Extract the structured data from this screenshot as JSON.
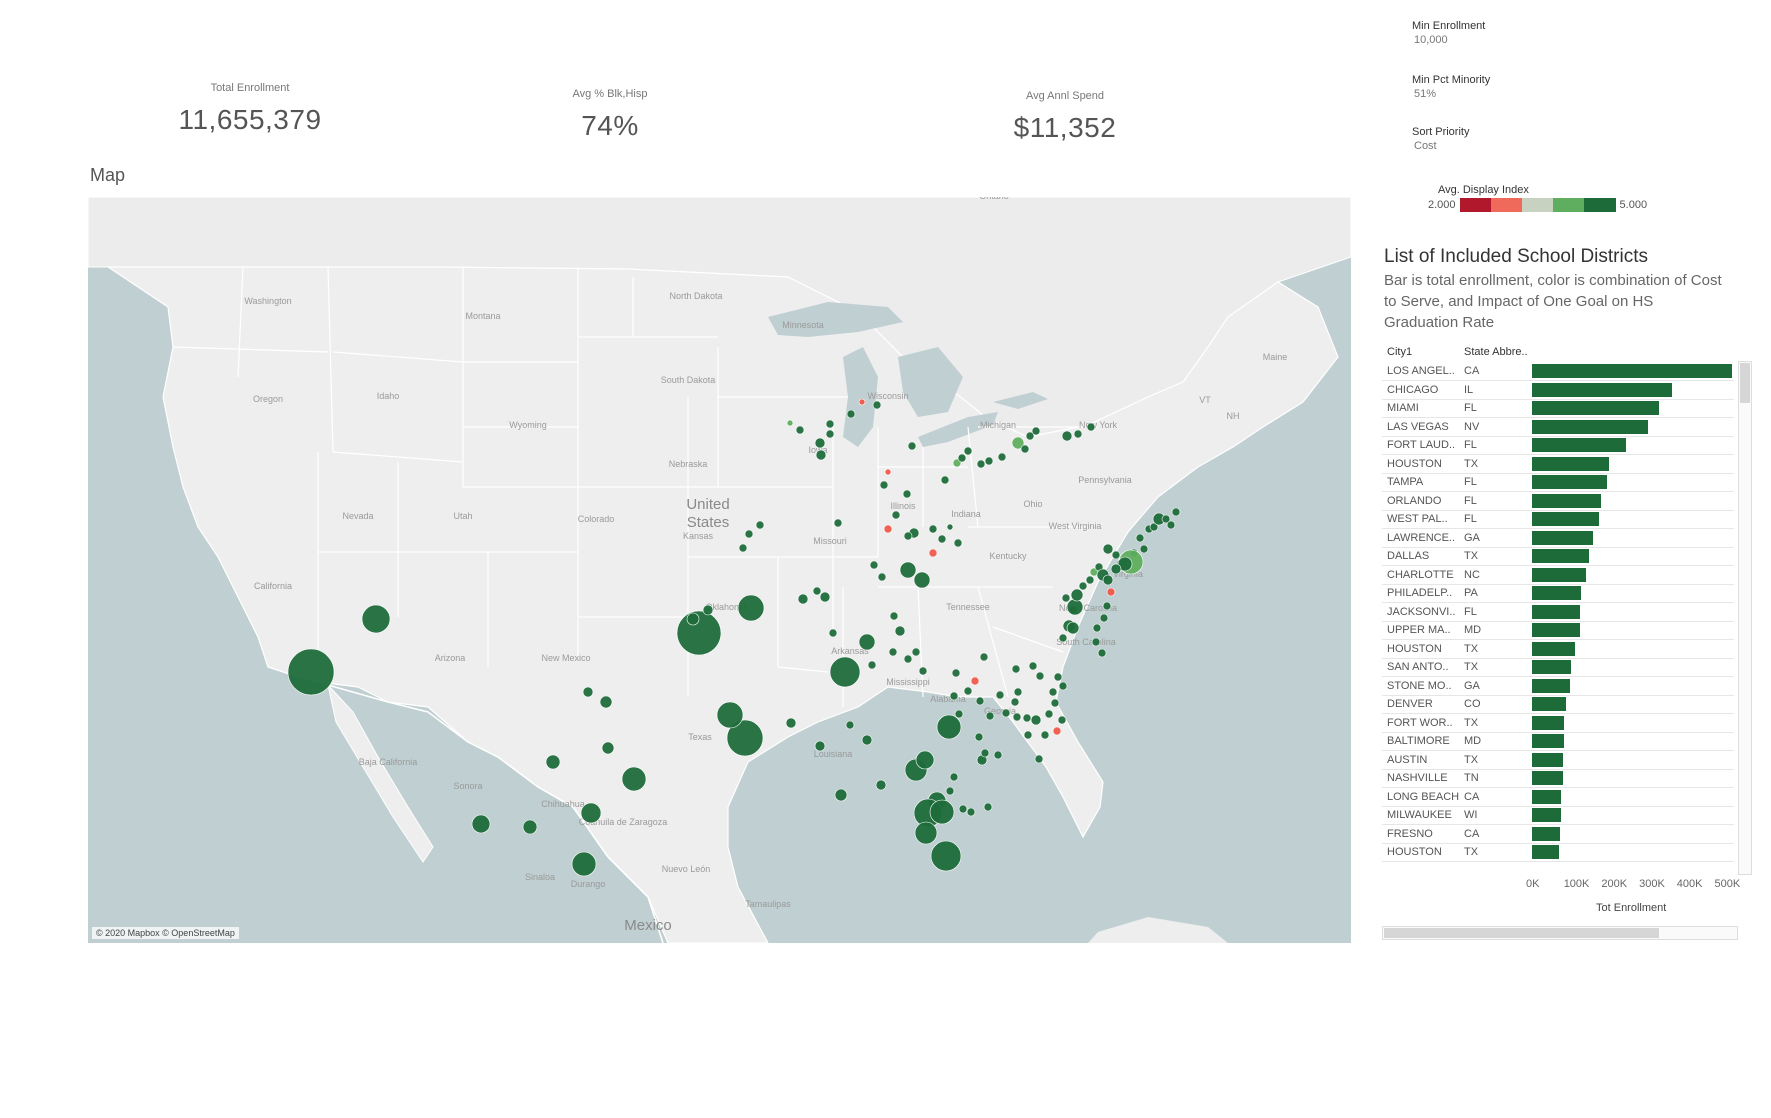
{
  "kpis": {
    "total_enrollment": {
      "label": "Total Enrollment",
      "value": "11,655,379"
    },
    "avg_pct_blk_hisp": {
      "label": "Avg % Blk,Hisp",
      "value": "74%"
    },
    "avg_annl_spend": {
      "label": "Avg Annl Spend",
      "value": "$11,352"
    }
  },
  "filters": [
    {
      "label": "Min Enrollment",
      "value": "10,000"
    },
    {
      "label": "Min Pct Minority",
      "value": "51%"
    },
    {
      "label": "Sort Priority",
      "value": "Cost"
    }
  ],
  "legend": {
    "title": "Avg. Display Index",
    "min": "2.000",
    "max": "5.000",
    "colors": [
      "#b2182b",
      "#ef6a5a",
      "#c7d3c0",
      "#5fae5f",
      "#1e6b3a"
    ]
  },
  "map": {
    "title": "Map",
    "attribution": "© 2020 Mapbox © OpenStreetMap",
    "colors": {
      "water": "#c0cfd1",
      "land": "#eeeeee",
      "border": "#ffffff",
      "dot_high": "#1e6b3a",
      "dot_low": "#ef5a4a",
      "dot_mid": "#5fae5f"
    },
    "labels": [
      {
        "text": "Washington"
      },
      {
        "text": "Montana"
      },
      {
        "text": "North Dakota"
      },
      {
        "text": "Minnesota"
      },
      {
        "text": "Oregon"
      },
      {
        "text": "Idaho"
      },
      {
        "text": "South Dakota"
      },
      {
        "text": "Wisconsin"
      },
      {
        "text": "Wyoming"
      },
      {
        "text": "Michigan"
      },
      {
        "text": "New York"
      },
      {
        "text": "Iowa"
      },
      {
        "text": "Nebraska"
      },
      {
        "text": "Nevada"
      },
      {
        "text": "Utah"
      },
      {
        "text": "Colorado"
      },
      {
        "text": "United States"
      },
      {
        "text": "Illinois"
      },
      {
        "text": "Indiana"
      },
      {
        "text": "Ohio"
      },
      {
        "text": "Pennsylvania"
      },
      {
        "text": "Kansas"
      },
      {
        "text": "Missouri"
      },
      {
        "text": "Kentucky"
      },
      {
        "text": "West Virginia"
      },
      {
        "text": "Virginia"
      },
      {
        "text": "California"
      },
      {
        "text": "Oklahoma"
      },
      {
        "text": "Tennessee"
      },
      {
        "text": "North Carolina"
      },
      {
        "text": "Arizona"
      },
      {
        "text": "New Mexico"
      },
      {
        "text": "Arkansas"
      },
      {
        "text": "South Carolina"
      },
      {
        "text": "Mississippi"
      },
      {
        "text": "Alabama"
      },
      {
        "text": "Georgia"
      },
      {
        "text": "Texas"
      },
      {
        "text": "Louisiana"
      },
      {
        "text": "Sonora"
      },
      {
        "text": "Chihuahua"
      },
      {
        "text": "Coahuila de Zaragoza"
      },
      {
        "text": "Nuevo León"
      },
      {
        "text": "Durango"
      },
      {
        "text": "Sinaloa"
      },
      {
        "text": "Tamaulipas"
      },
      {
        "text": "Mexico"
      },
      {
        "text": "Maine"
      },
      {
        "text": "Baja California"
      },
      {
        "text": "Ontario"
      },
      {
        "text": "VT"
      },
      {
        "text": "NH"
      }
    ]
  },
  "list": {
    "title": "List of Included School Districts",
    "subtitle": "Bar is total enrollment, color is combination of Cost to Serve, and Impact of One Goal on HS Graduation Rate",
    "columns": [
      "City1",
      "State Abbre.."
    ],
    "axis_title": "Tot Enrollment",
    "axis_ticks": [
      "0K",
      "100K",
      "200K",
      "300K",
      "400K",
      "500K"
    ],
    "rows": [
      {
        "city": "LOS ANGEL..",
        "state": "CA",
        "enrollment": 530000
      },
      {
        "city": "CHICAGO",
        "state": "IL",
        "enrollment": 371000
      },
      {
        "city": "MIAMI",
        "state": "FL",
        "enrollment": 337000
      },
      {
        "city": "LAS VEGAS",
        "state": "NV",
        "enrollment": 308000
      },
      {
        "city": "FORT LAUD..",
        "state": "FL",
        "enrollment": 250000
      },
      {
        "city": "HOUSTON",
        "state": "TX",
        "enrollment": 205000
      },
      {
        "city": "TAMPA",
        "state": "FL",
        "enrollment": 198000
      },
      {
        "city": "ORLANDO",
        "state": "FL",
        "enrollment": 182000
      },
      {
        "city": "WEST PAL..",
        "state": "FL",
        "enrollment": 178000
      },
      {
        "city": "LAWRENCE..",
        "state": "GA",
        "enrollment": 162000
      },
      {
        "city": "DALLAS",
        "state": "TX",
        "enrollment": 152000
      },
      {
        "city": "CHARLOTTE",
        "state": "NC",
        "enrollment": 143000
      },
      {
        "city": "PHILADELP..",
        "state": "PA",
        "enrollment": 130000
      },
      {
        "city": "JACKSONVI..",
        "state": "FL",
        "enrollment": 128000
      },
      {
        "city": "UPPER MA..",
        "state": "MD",
        "enrollment": 128000
      },
      {
        "city": "HOUSTON",
        "state": "TX",
        "enrollment": 113000
      },
      {
        "city": "SAN ANTO..",
        "state": "TX",
        "enrollment": 104000
      },
      {
        "city": "STONE MO..",
        "state": "GA",
        "enrollment": 100000
      },
      {
        "city": "DENVER",
        "state": "CO",
        "enrollment": 90000
      },
      {
        "city": "FORT WOR..",
        "state": "TX",
        "enrollment": 85000
      },
      {
        "city": "BALTIMORE",
        "state": "MD",
        "enrollment": 84000
      },
      {
        "city": "AUSTIN",
        "state": "TX",
        "enrollment": 83000
      },
      {
        "city": "NASHVILLE",
        "state": "TN",
        "enrollment": 83000
      },
      {
        "city": "LONG BEACH",
        "state": "CA",
        "enrollment": 76000
      },
      {
        "city": "MILWAUKEE",
        "state": "WI",
        "enrollment": 76000
      },
      {
        "city": "FRESNO",
        "state": "CA",
        "enrollment": 73000
      },
      {
        "city": "HOUSTON",
        "state": "TX",
        "enrollment": 72000
      }
    ]
  }
}
